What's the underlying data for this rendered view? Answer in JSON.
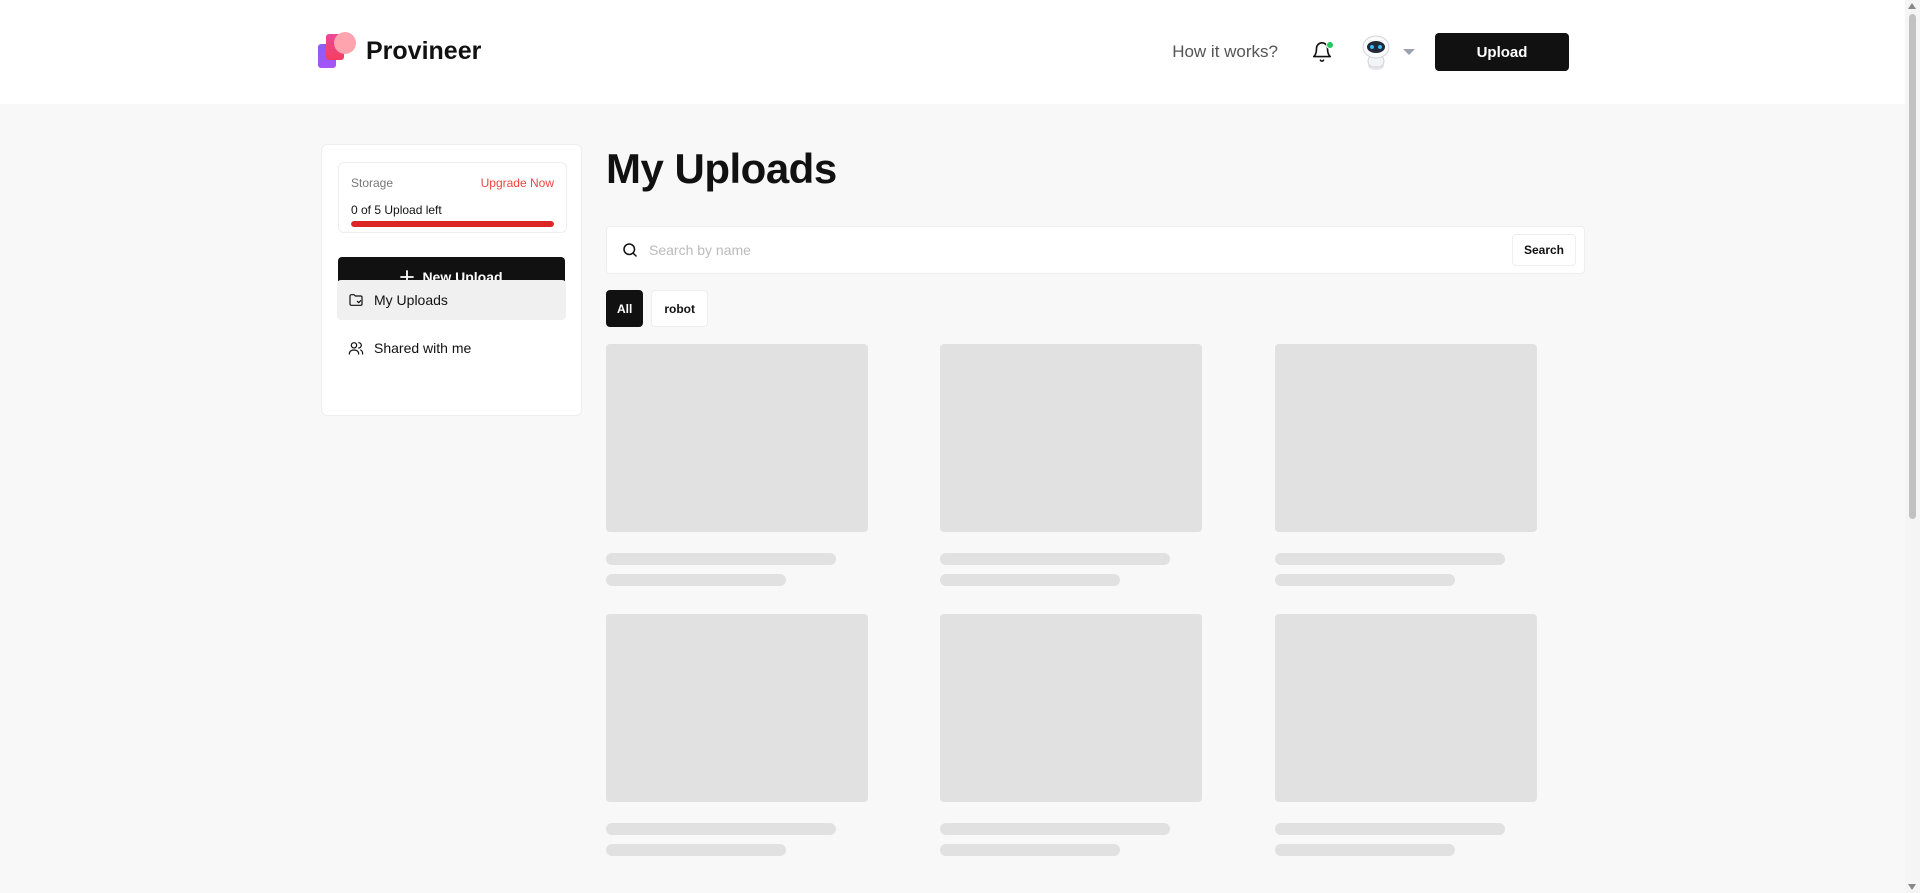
{
  "header": {
    "brand_name": "Provineer",
    "how_it_works": "How it works?",
    "upload_label": "Upload",
    "notification_dot_color": "#22c55e"
  },
  "sidebar": {
    "storage": {
      "label": "Storage",
      "upgrade_label": "Upgrade Now",
      "count_text": "0 of 5 Upload left",
      "used_fraction": 1.0,
      "bar_color": "#dc2626"
    },
    "new_upload_label": "New Upload",
    "items": [
      {
        "label": "My Uploads",
        "icon": "folder-icon",
        "active": true
      },
      {
        "label": "Shared with me",
        "icon": "users-icon",
        "active": false
      }
    ]
  },
  "main": {
    "title": "My Uploads",
    "search": {
      "placeholder": "Search by name",
      "value": "",
      "button_label": "Search"
    },
    "filters": [
      {
        "label": "All",
        "active": true
      },
      {
        "label": "robot",
        "active": false
      }
    ],
    "loading_placeholders": 6
  },
  "colors": {
    "accent": "#111111",
    "danger": "#ef4444"
  }
}
